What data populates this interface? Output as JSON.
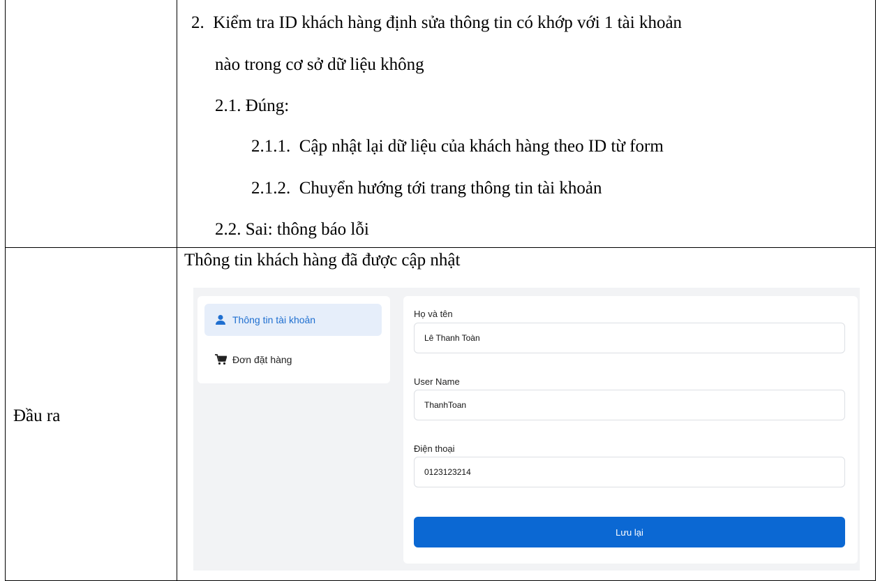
{
  "doc": {
    "step2": "2.  Kiểm tra ID khách hàng định sửa thông tin có khớp với 1 tài khoản",
    "step2_cont": "nào trong cơ sở dữ liệu không",
    "step2_1": "2.1. Đúng:",
    "step2_1_1": "2.1.1.  Cập nhật lại dữ liệu của khách hàng theo ID từ form",
    "step2_1_2": "2.1.2.  Chuyển hướng tới trang thông tin tài khoản",
    "step2_2": "2.2. Sai: thông báo lỗi",
    "output_label": "Đầu ra",
    "output_text": "Thông tin khách hàng đã được cập nhật"
  },
  "screenshot": {
    "sidebar": {
      "items": [
        {
          "label": "Thông tin tài khoản",
          "icon": "user-icon",
          "active": true
        },
        {
          "label": "Đơn đặt hàng",
          "icon": "cart-icon",
          "active": false
        }
      ]
    },
    "form": {
      "fields": [
        {
          "label": "Họ và tên",
          "value": "Lê Thanh Toàn"
        },
        {
          "label": "User Name",
          "value": "ThanhToan"
        },
        {
          "label": "Điện thoại",
          "value": "0123123214"
        }
      ],
      "submit_label": "Lưu lại"
    },
    "colors": {
      "accent": "#0b68d3",
      "active_bg": "#e6eefa",
      "panel_bg": "#f2f3f5"
    }
  }
}
